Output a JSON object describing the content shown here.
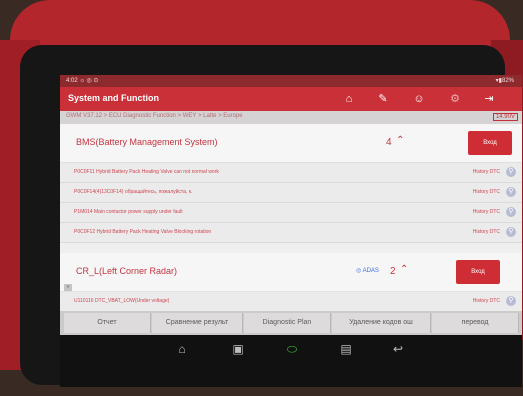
{
  "window": {
    "title": "System and Function"
  },
  "statusbar": {
    "left": "4:02 ☼ ◎ ⊙",
    "right": "▾▮82%"
  },
  "toolbar": {
    "icons": [
      "home-icon",
      "report-icon",
      "user-icon",
      "settings-icon",
      "exit-icon"
    ]
  },
  "breadcrumb": "GWM V37.12 > ECU Diagnostic Function > WEY > Latte > Europe",
  "voltage": "14.90V",
  "bms": {
    "title": "BMS(Battery Management System)",
    "count": "4",
    "enter_label": "Вход",
    "dtcs": [
      {
        "text": "P0C0F11 Hybrid Battery Pack Heating Valve can not normal work",
        "history": "History DTC"
      },
      {
        "text": "P0C0F14(4)13C0F14) обращайтесь, пожалуйста, к.",
        "history": "History DTC"
      },
      {
        "text": "P1M014 Main contactor power supply under fault",
        "history": "History DTC"
      },
      {
        "text": "P0C0F12 Hybrid Battery Pack Heating Valve Blocking rotation",
        "history": "History DTC"
      }
    ]
  },
  "crl": {
    "title": "CR_L(Left Corner Radar)",
    "adas": "ADAS",
    "count": "2",
    "enter_label": "Вход",
    "dtcs": [
      {
        "text": "U110116 DTC_VBAT_LOW(Under voltage)",
        "history": "History DTC"
      }
    ]
  },
  "bottom_buttons": [
    "Отчет",
    "Сравнение результ",
    "Diagnostic Plan",
    "Удаление кодов ош",
    "перевод"
  ],
  "nav": [
    "home-icon",
    "recent-apps-icon",
    "vci-icon",
    "screenshot-icon",
    "back-icon"
  ]
}
